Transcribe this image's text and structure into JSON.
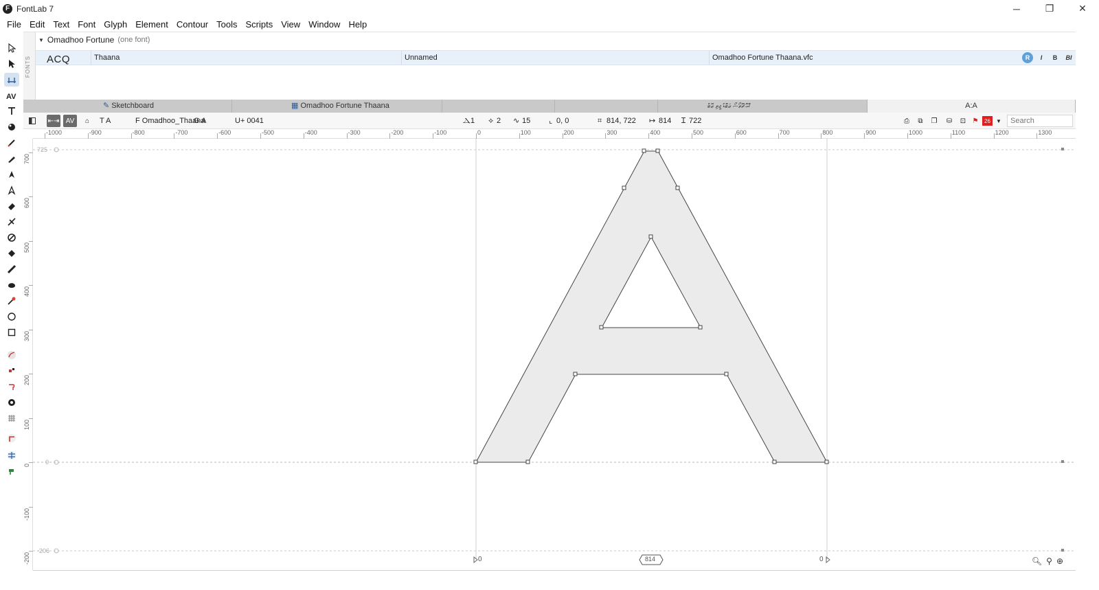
{
  "app": {
    "title": "FontLab 7",
    "logo_letter": "F",
    "window_controls": {
      "minimize": "─",
      "restore": "❐",
      "close": "✕"
    }
  },
  "menu": [
    "File",
    "Edit",
    "Text",
    "Font",
    "Glyph",
    "Element",
    "Contour",
    "Tools",
    "Scripts",
    "View",
    "Window",
    "Help"
  ],
  "fonts_panel": {
    "side_label": "FONTS",
    "family_name": "Omadhoo Fortune",
    "family_sub": "(one font)",
    "preview": "ACQ",
    "row": {
      "style": "Thaana",
      "name": "Unnamed",
      "file": "Omadhoo Fortune Thaana.vfc"
    },
    "style_buttons": [
      "R",
      "I",
      "B",
      "BI"
    ]
  },
  "tabs": {
    "sketchboard": "Sketchboard",
    "font_window": "Omadhoo Fortune Thaana",
    "text_preview": "ޤޮޢޮޗޫތޯސޯ ޒަޓޮޑު ޖީތި ޒޭޓް",
    "glyph_tab": "A:A"
  },
  "infobar": {
    "text_mode": "T A",
    "font_name": "F Omadhoo_Thaana",
    "glyph_name": "G A",
    "unicode": "U+ 0041",
    "layers": "1",
    "contours": "2",
    "nodes": "15",
    "origin": "0, 0",
    "dimensions": "814, 722",
    "advance_width": "814",
    "height": "722",
    "badge": "26",
    "search_placeholder": "Search"
  },
  "rulers": {
    "h_labels": [
      "-1000",
      "-900",
      "-800",
      "-700",
      "-600",
      "-500",
      "-400",
      "-300",
      "-200",
      "-100",
      "0",
      "100",
      "200",
      "300",
      "400",
      "500",
      "600",
      "700",
      "800",
      "900",
      "1000",
      "1100",
      "1200",
      "1300"
    ],
    "v_labels": [
      "700",
      "600",
      "500",
      "400",
      "300",
      "200",
      "100",
      "0",
      "-100",
      "-200"
    ]
  },
  "metrics": {
    "ascender": "725",
    "baseline": "0",
    "descender": "-206"
  },
  "sidebearings": {
    "left": "0",
    "width": "814",
    "right": "0"
  },
  "colors": {
    "glyph_fill": "#ebebeb",
    "outline": "#444444",
    "accent": "#5ea0d8",
    "active_tab": "#f1f1f1",
    "tab_bar": "#c9c9c9"
  }
}
